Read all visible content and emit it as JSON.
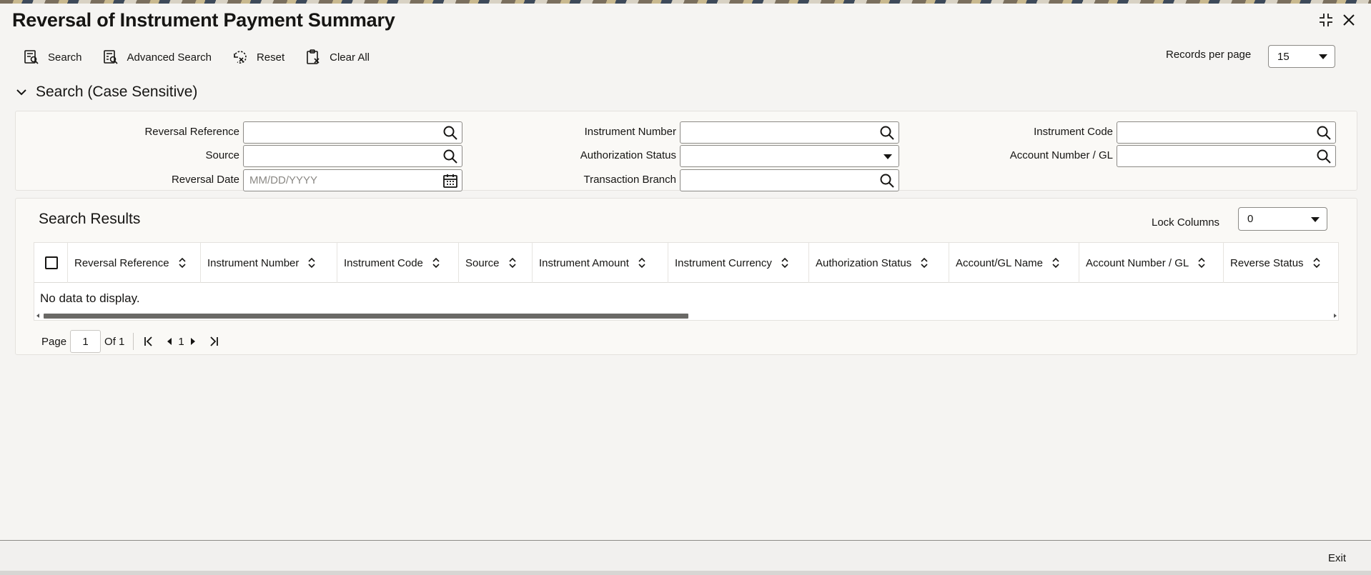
{
  "page": {
    "title": "Reversal of Instrument Payment Summary"
  },
  "toolbar": {
    "search": "Search",
    "advanced_search": "Advanced Search",
    "reset": "Reset",
    "clear_all": "Clear All"
  },
  "records_per_page": {
    "label": "Records per page",
    "value": "15"
  },
  "search_section": {
    "title": "Search (Case Sensitive)"
  },
  "fields": {
    "reversal_reference": {
      "label": "Reversal Reference",
      "value": ""
    },
    "source": {
      "label": "Source",
      "value": ""
    },
    "reversal_date": {
      "label": "Reversal Date",
      "placeholder": "MM/DD/YYYY"
    },
    "instrument_number": {
      "label": "Instrument Number",
      "value": ""
    },
    "authorization_status": {
      "label": "Authorization Status",
      "value": ""
    },
    "transaction_branch": {
      "label": "Transaction Branch",
      "value": ""
    },
    "instrument_code": {
      "label": "Instrument Code",
      "value": ""
    },
    "account_number_gl": {
      "label": "Account Number / GL",
      "value": ""
    }
  },
  "results": {
    "title": "Search Results",
    "lock_columns_label": "Lock Columns",
    "lock_columns_value": "0",
    "columns": [
      "Reversal Reference",
      "Instrument Number",
      "Instrument Code",
      "Source",
      "Instrument Amount",
      "Instrument Currency",
      "Authorization Status",
      "Account/GL Name",
      "Account Number / GL",
      "Reverse Status"
    ],
    "empty_message": "No data to display."
  },
  "pager": {
    "page_label": "Page",
    "page_value": "1",
    "of_label": "Of 1",
    "current": "1"
  },
  "footer": {
    "exit": "Exit"
  },
  "icons": {
    "search": "search-icon",
    "advanced_search": "advanced-search-icon",
    "reset": "reset-icon",
    "clear_all": "clear-all-icon",
    "calendar": "calendar-icon",
    "sort": "sort-icon",
    "collapse": "chevron-down-icon",
    "minimize": "minimize-icon",
    "close": "close-icon"
  }
}
